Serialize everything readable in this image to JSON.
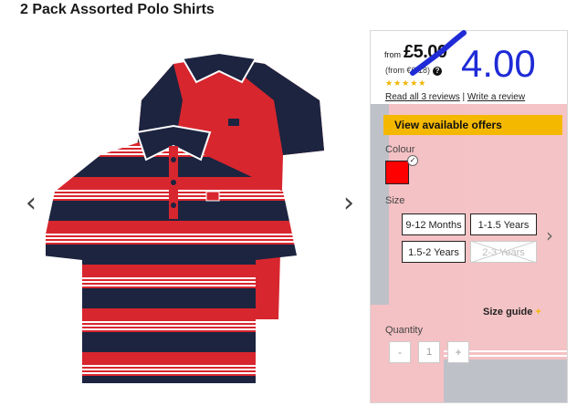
{
  "page": {
    "title": "2 Pack Assorted Polo Shirts"
  },
  "gallery": {
    "prev_icon": "chevron-left-icon",
    "next_icon": "chevron-right-icon",
    "prev_glyph": "‹",
    "next_glyph": "›"
  },
  "price": {
    "from_label": "from",
    "amount": "£5.00",
    "secondary": "(from €6.18)",
    "info_glyph": "?",
    "stars": "★★★★★"
  },
  "reviews": {
    "read_label": "Read all 3 reviews",
    "separator": "|",
    "write_label": "Write a review"
  },
  "offers": {
    "label": "View available offers"
  },
  "colour": {
    "label": "Colour",
    "selected_hex": "#ff0000",
    "check_glyph": "✓"
  },
  "size": {
    "label": "Size",
    "options": [
      {
        "label": "9-12 Months",
        "available": true
      },
      {
        "label": "1-1.5 Years",
        "available": true
      },
      {
        "label": "1.5-2 Years",
        "available": true
      },
      {
        "label": "2-3 Years",
        "available": false
      }
    ],
    "next_glyph": "›",
    "guide_label": "Size guide",
    "guide_plus": "+"
  },
  "quantity": {
    "label": "Quantity",
    "minus": "-",
    "value": "1",
    "plus": "+"
  },
  "annotation": {
    "text": "4.00",
    "color": "#1f2bd6"
  },
  "colors": {
    "accent": "#f5b800",
    "stripe_red": "#d8262e",
    "stripe_navy": "#1c2440"
  }
}
